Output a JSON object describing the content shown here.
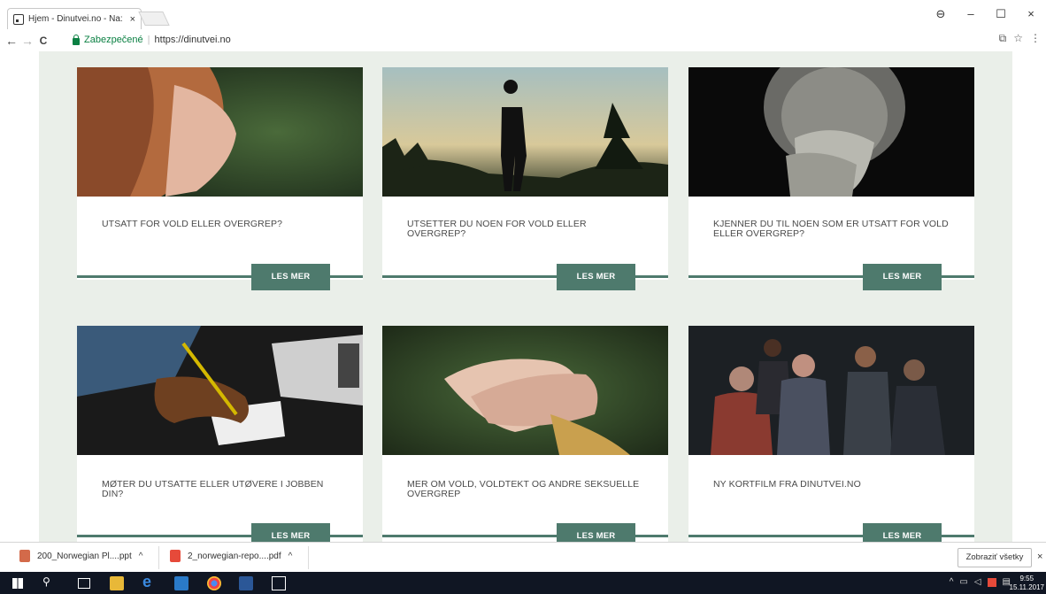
{
  "browser": {
    "tab_title": "Hjem - Dinutvei.no - Na:",
    "tab_close": "×",
    "secure_label": "Zabezpečené",
    "url": "https://dinutvei.no",
    "window_controls": [
      "–",
      "☐",
      "×"
    ],
    "nav": {
      "back": "←",
      "forward": "→",
      "reload": "C"
    }
  },
  "cards": [
    {
      "title": "UTSATT FOR VOLD ELLER OVERGREP?",
      "button": "LES MER",
      "image": "woman-profile"
    },
    {
      "title": "UTSETTER DU NOEN FOR VOLD ELLER OVERGREP?",
      "button": "LES MER",
      "image": "silhouette-sunset"
    },
    {
      "title": "KJENNER DU TIL NOEN SOM ER UTSATT FOR VOLD ELLER OVERGREP?",
      "button": "LES MER",
      "image": "elderly-man"
    },
    {
      "title": "MØTER DU UTSATTE ELLER UTØVERE I JOBBEN DIN?",
      "button": "LES MER",
      "image": "writing-hand"
    },
    {
      "title": "MER OM VOLD, VOLDTEKT OG ANDRE SEKSUELLE OVERGREP",
      "button": "LES MER",
      "image": "raised-hands"
    },
    {
      "title": "NY KORTFILM FRA DINUTVEI.NO",
      "button": "LES MER",
      "image": "group-people"
    }
  ],
  "downloads": {
    "items": [
      {
        "name": "200_Norwegian Pl....ppt",
        "icon": "ppt-icon"
      },
      {
        "name": "2_norwegian-repo....pdf",
        "icon": "pdf-icon"
      }
    ],
    "show_all": "Zobraziť všetky",
    "close": "×"
  },
  "taskbar": {
    "time": "9:55",
    "date": "15.11.2017"
  },
  "colors": {
    "accent": "#4e7a6d",
    "page_bg": "#eaefe9",
    "taskbar": "#101623"
  }
}
